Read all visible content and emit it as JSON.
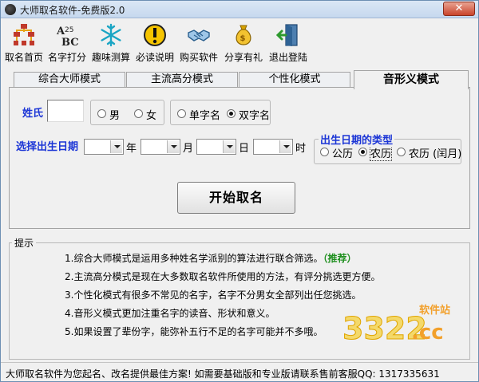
{
  "window": {
    "title": "大师取名软件-免费版2.0",
    "close": "✕"
  },
  "toolbar": [
    {
      "label": "取名首页",
      "icon": "home-grid-icon"
    },
    {
      "label": "名字打分",
      "icon": "abc-score-icon"
    },
    {
      "label": "趣味测算",
      "icon": "snowflake-icon"
    },
    {
      "label": "必读说明",
      "icon": "exclamation-icon"
    },
    {
      "label": "购买软件",
      "icon": "handshake-icon"
    },
    {
      "label": "分享有礼",
      "icon": "money-bag-icon"
    },
    {
      "label": "退出登陆",
      "icon": "exit-door-icon"
    }
  ],
  "tabs": [
    "综合大师模式",
    "主流高分模式",
    "个性化模式",
    "音形义模式"
  ],
  "active_tab": 3,
  "form": {
    "surname_label": "姓氏",
    "surname_value": "",
    "gender": {
      "male": "男",
      "female": "女",
      "selected": "none"
    },
    "name_length": {
      "single": "单字名",
      "double": "双字名",
      "selected": "double"
    },
    "birth_label": "选择出生日期",
    "units": {
      "year": "年",
      "month": "月",
      "day": "日",
      "hour": "时"
    },
    "birth_type": {
      "legend": "出生日期的类型",
      "gregorian": "公历",
      "lunar": "农历",
      "lunar_leap": "农历 (闰月)",
      "selected": "lunar"
    },
    "start_button": "开始取名"
  },
  "tips": {
    "legend": "提示",
    "items": [
      {
        "text": "1.综合大师模式是运用多种姓名学派别的算法进行联合筛选。",
        "highlight": "（推荐）"
      },
      {
        "text": "2.主流高分模式是现在大多数取名软件所使用的方法，有评分挑选更方便。",
        "highlight": ""
      },
      {
        "text": "3.个性化模式有很多不常见的名字，名字不分男女全部列出任您挑选。",
        "highlight": ""
      },
      {
        "text": "4.音形义模式更加注重名字的读音、形状和意义。",
        "highlight": ""
      },
      {
        "text": "5.如果设置了辈份字，能弥补五行不足的名字可能并不多哦。",
        "highlight": ""
      }
    ]
  },
  "watermark": {
    "brand": "3322",
    "suffix": ".cc",
    "tag": "软件站"
  },
  "status": {
    "text": "大师取名软件为您起名、改名提供最佳方案! 如需要基础版和专业版请联系售前客服QQ: 1317335631"
  },
  "colors": {
    "accent_blue": "#1b35d6",
    "green": "#1e8f1e"
  }
}
